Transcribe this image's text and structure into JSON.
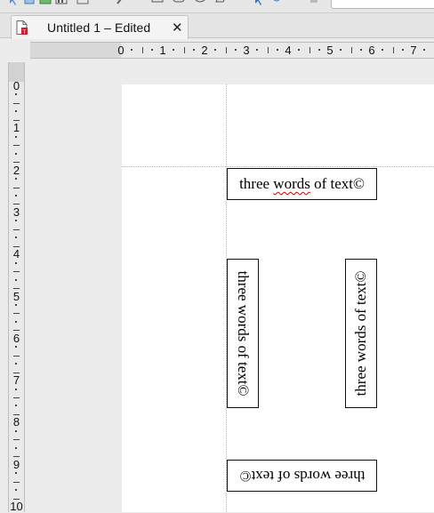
{
  "tab": {
    "title": "Untitled 1 – Edited",
    "close_label": "✕"
  },
  "ruler_horizontal": {
    "labels": [
      "0",
      "1",
      "2",
      "3",
      "4",
      "5",
      "6",
      "7"
    ]
  },
  "ruler_vertical": {
    "labels": [
      "0",
      "1",
      "2",
      "3",
      "4",
      "5",
      "6",
      "7",
      "8",
      "9",
      "10"
    ]
  },
  "document": {
    "frames": [
      {
        "text": "three words of text©",
        "misspelled": "words",
        "rotation": 0
      },
      {
        "text": "three words of text©",
        "rotation": 90
      },
      {
        "text": "three words of text©",
        "rotation": -90
      },
      {
        "text": "three words of text©",
        "rotation": 180
      }
    ]
  },
  "colors": {
    "spellcheck_underline": "#d40000",
    "page": "#ffffff",
    "workspace": "#ececec"
  }
}
